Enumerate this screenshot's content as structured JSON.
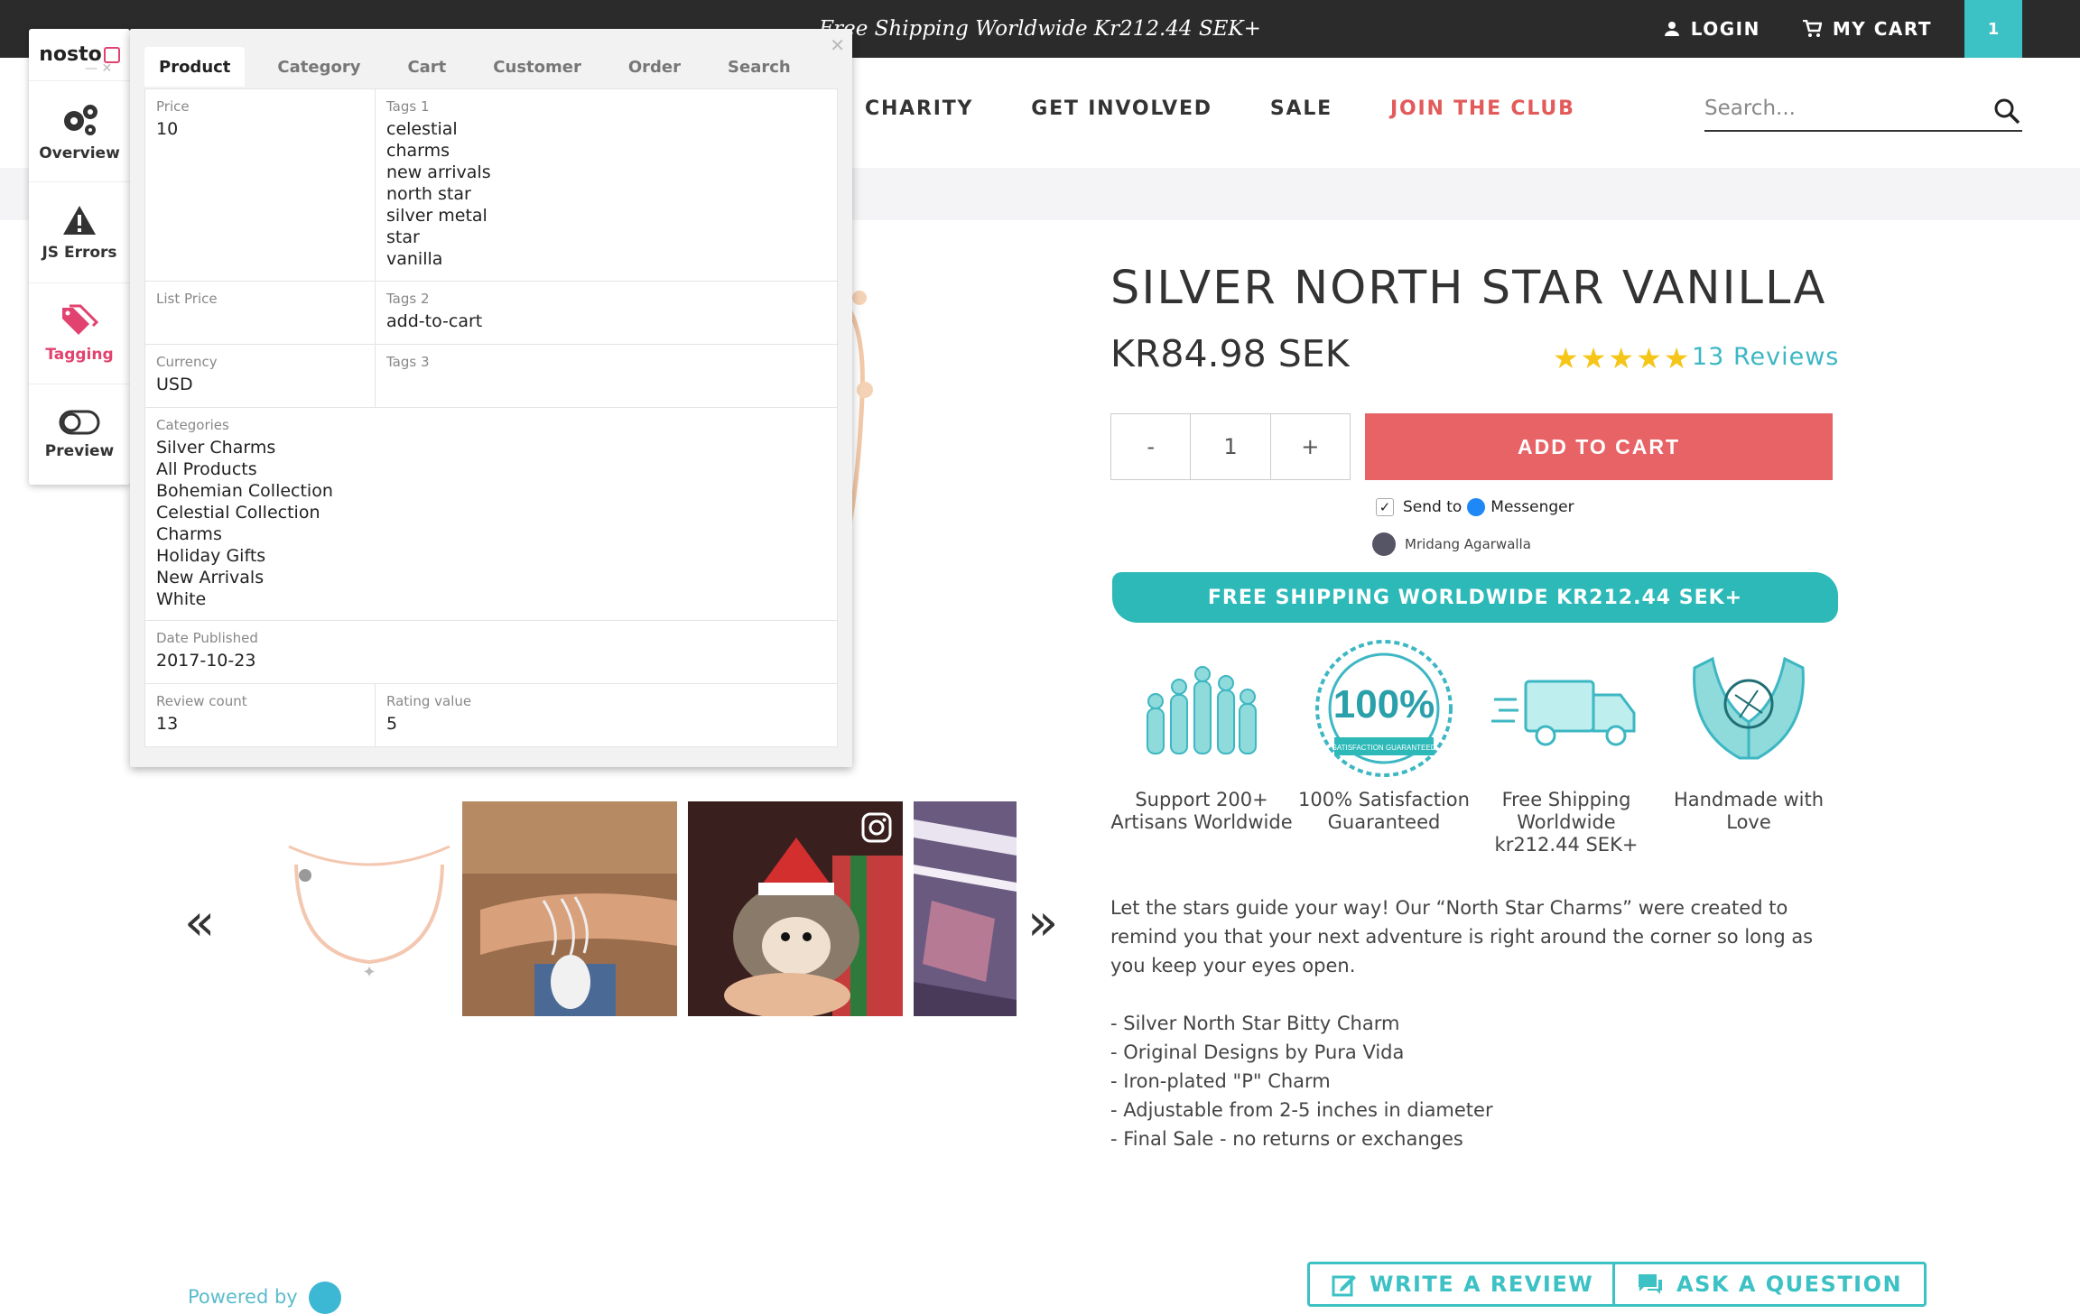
{
  "topbar": {
    "promo": "Free Shipping Worldwide Kr212.44 SEK+",
    "login": "LOGIN",
    "my_cart": "MY CART",
    "cart_count": "1"
  },
  "nav": {
    "items": [
      "CHARITY",
      "GET INVOLVED",
      "SALE",
      "JOIN THE CLUB"
    ],
    "search_placeholder": "Search..."
  },
  "product": {
    "title": "SILVER NORTH STAR VANILLA",
    "price": "KR84.98 SEK",
    "stars": "★★★★★",
    "reviews": "13 Reviews",
    "qty_minus": "-",
    "qty_value": "1",
    "qty_plus": "+",
    "add_to_cart": "ADD TO CART",
    "send_to": "Send to",
    "messenger": "Messenger",
    "messenger_user": "Mridang Agarwalla",
    "shipping_banner": "FREE SHIPPING WORLDWIDE  KR212.44 SEK+",
    "features": [
      "Support 200+ Artisans Worldwide",
      "100% Satisfaction Guaranteed",
      "Free Shipping Worldwide kr212.44 SEK+",
      "Handmade with Love"
    ],
    "badge_text": "100%",
    "badge_sub": "SATISFACTION GUARANTEED",
    "description": "Let the stars guide your way! Our “North Star Charms” were created to remind you that your next adventure is right around the corner so long as you keep your eyes open.",
    "bullets": [
      "- Silver North Star Bitty Charm",
      "- Original Designs by Pura Vida",
      "- Iron-plated \"P\" Charm",
      "- Adjustable from 2-5 inches in diameter",
      "- Final Sale - no returns or exchanges"
    ]
  },
  "gallery": {
    "prev": "«",
    "next": "»"
  },
  "reviews_footer": {
    "powered_by": "Powered by",
    "write_review": "WRITE A REVIEW",
    "ask_question": "ASK A QUESTION"
  },
  "nosto": {
    "logo": "nosto",
    "side_items": [
      "Overview",
      "JS Errors",
      "Tagging",
      "Preview"
    ],
    "tabs": [
      "Product",
      "Category",
      "Cart",
      "Customer",
      "Order",
      "Search"
    ],
    "fields": {
      "price_label": "Price",
      "price": "10",
      "tags1_label": "Tags 1",
      "tags1": [
        "celestial",
        "charms",
        "new arrivals",
        "north star",
        "silver metal",
        "star",
        "vanilla"
      ],
      "list_price_label": "List Price",
      "list_price": "",
      "tags2_label": "Tags 2",
      "tags2": "add-to-cart",
      "currency_label": "Currency",
      "currency": "USD",
      "tags3_label": "Tags 3",
      "tags3": "",
      "categories_label": "Categories",
      "categories": [
        "Silver Charms",
        "All Products",
        "Bohemian Collection",
        "Celestial Collection",
        "Charms",
        "Holiday Gifts",
        "New Arrivals",
        "White"
      ],
      "date_label": "Date Published",
      "date": "2017-10-23",
      "review_count_label": "Review count",
      "review_count": "13",
      "rating_label": "Rating value",
      "rating": "5"
    }
  }
}
